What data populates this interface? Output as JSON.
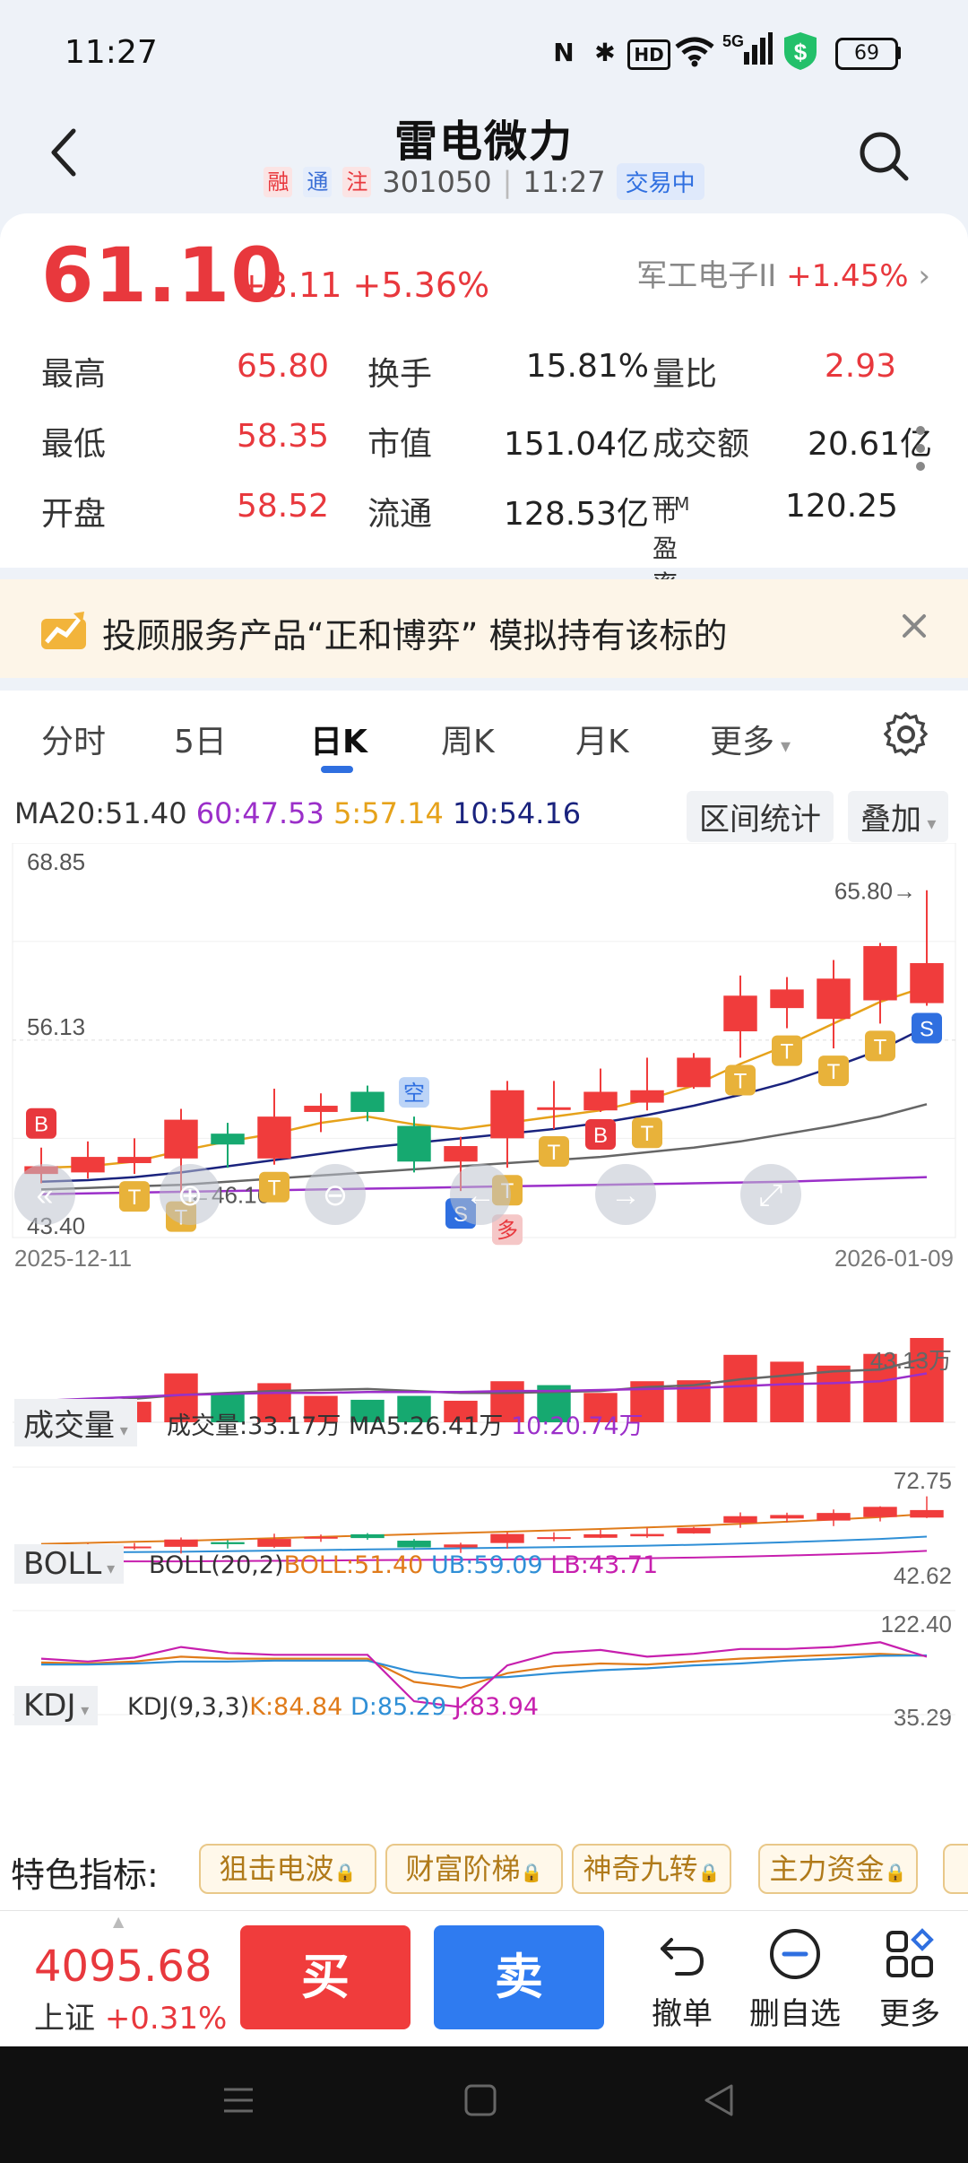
{
  "status_bar": {
    "time": "11:27",
    "nfc": "N",
    "hd": "HD",
    "net": "5G",
    "battery": "69"
  },
  "header": {
    "title": "雷电微力",
    "tags": [
      "融",
      "通",
      "注"
    ],
    "code": "301050",
    "time": "11:27",
    "trading_status": "交易中"
  },
  "quote": {
    "price": "61.10",
    "change": "+3.11",
    "change_pct": "+5.36%",
    "sector_name": "军工电子II",
    "sector_pct": "+1.45%",
    "rows": [
      {
        "l1": "最高",
        "v1": "65.80",
        "l2": "换手",
        "v2": "15.81%",
        "l3": "量比",
        "v3": "2.93"
      },
      {
        "l1": "最低",
        "v1": "58.35",
        "l2": "市值",
        "v2": "151.04亿",
        "l3": "成交额",
        "v3": "20.61亿"
      },
      {
        "l1": "开盘",
        "v1": "58.52",
        "l2": "流通",
        "v2": "128.53亿",
        "l3": "市盈率",
        "l3_sup": "TTM",
        "v3": "120.25"
      }
    ]
  },
  "banner": {
    "text": "投顾服务产品“正和博弈” 模拟持有该标的"
  },
  "tabs": [
    "分时",
    "5日",
    "日K",
    "周K",
    "月K",
    "更多"
  ],
  "active_tab": "日K",
  "ma_legend": {
    "ma20": "MA20:51.40",
    "ma60": "60:47.53",
    "ma5": "5:57.14",
    "ma10": "10:54.16"
  },
  "chart_buttons": {
    "range_stats": "区间统计",
    "overlay": "叠加"
  },
  "chart_data": [
    {
      "type": "candlestick",
      "y_labels": [
        "68.85",
        "56.13",
        "43.40"
      ],
      "high_label": "65.80",
      "low_label": "46.16",
      "x_start": "2025-12-11",
      "x_end": "2026-01-09",
      "candles": [
        {
          "o": 47.5,
          "c": 48.0,
          "h": 49.2,
          "l": 46.9
        },
        {
          "o": 47.6,
          "c": 48.6,
          "h": 49.6,
          "l": 47.2
        },
        {
          "o": 48.2,
          "c": 48.6,
          "h": 49.8,
          "l": 47.5
        },
        {
          "o": 48.5,
          "c": 51.0,
          "h": 51.7,
          "l": 46.2
        },
        {
          "o": 50.1,
          "c": 49.4,
          "h": 50.8,
          "l": 47.9
        },
        {
          "o": 48.5,
          "c": 51.2,
          "h": 53.0,
          "l": 48.1
        },
        {
          "o": 51.5,
          "c": 51.9,
          "h": 52.7,
          "l": 50.2
        },
        {
          "o": 52.8,
          "c": 51.5,
          "h": 53.2,
          "l": 50.9
        },
        {
          "o": 50.6,
          "c": 48.3,
          "h": 51.2,
          "l": 47.6
        },
        {
          "o": 48.3,
          "c": 49.3,
          "h": 49.9,
          "l": 46.4
        },
        {
          "o": 49.8,
          "c": 52.9,
          "h": 53.5,
          "l": 47.9
        },
        {
          "o": 51.8,
          "c": 51.8,
          "h": 53.5,
          "l": 50.4
        },
        {
          "o": 51.6,
          "c": 52.8,
          "h": 54.3,
          "l": 51.5
        },
        {
          "o": 52.1,
          "c": 52.9,
          "h": 55.0,
          "l": 51.6
        },
        {
          "o": 53.1,
          "c": 55.0,
          "h": 55.3,
          "l": 53.0
        },
        {
          "o": 56.7,
          "c": 59.0,
          "h": 60.3,
          "l": 55.0
        },
        {
          "o": 58.2,
          "c": 59.4,
          "h": 60.2,
          "l": 56.9
        },
        {
          "o": 57.5,
          "c": 60.1,
          "h": 61.3,
          "l": 55.6
        },
        {
          "o": 58.7,
          "c": 62.2,
          "h": 62.4,
          "l": 57.2
        },
        {
          "o": 58.52,
          "c": 61.1,
          "h": 65.8,
          "l": 58.35
        }
      ],
      "ma5": [
        47.9,
        48.0,
        48.3,
        49.0,
        49.6,
        50.1,
        50.8,
        51.2,
        50.7,
        50.4,
        50.8,
        51.2,
        51.6,
        52.3,
        53.2,
        54.6,
        55.8,
        57.2,
        58.6,
        59.6
      ],
      "ma10": [
        47.0,
        47.1,
        47.3,
        47.6,
        48.0,
        48.4,
        48.8,
        49.2,
        49.5,
        49.8,
        50.1,
        50.4,
        50.8,
        51.3,
        51.9,
        52.6,
        53.4,
        54.4,
        55.5,
        57.0
      ],
      "ma20": [
        46.5,
        46.6,
        46.7,
        46.8,
        47.0,
        47.2,
        47.4,
        47.6,
        47.8,
        48.0,
        48.2,
        48.4,
        48.6,
        48.9,
        49.2,
        49.6,
        50.1,
        50.6,
        51.2,
        52.0
      ],
      "ma60": [
        46.2,
        46.25,
        46.3,
        46.35,
        46.4,
        46.45,
        46.5,
        46.55,
        46.6,
        46.65,
        46.7,
        46.75,
        46.8,
        46.85,
        46.9,
        46.95,
        47.0,
        47.1,
        47.2,
        47.3
      ],
      "markers": [
        {
          "i": 0,
          "label": "B",
          "pos": "above",
          "color": "#e8383d"
        },
        {
          "i": 2,
          "label": "T",
          "pos": "below",
          "color": "#e8b23a"
        },
        {
          "i": 3,
          "label": "T",
          "pos": "below",
          "color": "#e8b23a"
        },
        {
          "i": 5,
          "label": "T",
          "pos": "below",
          "color": "#e8b23a"
        },
        {
          "i": 8,
          "label": "空",
          "pos": "above",
          "color": "#bcd4f7"
        },
        {
          "i": 9,
          "label": "S",
          "pos": "below",
          "color": "#2f6fe0"
        },
        {
          "i": 10,
          "label": "多",
          "pos": "below2",
          "color": "#f5c7c7"
        },
        {
          "i": 10,
          "label": "T",
          "pos": "below",
          "color": "#e8b23a"
        },
        {
          "i": 11,
          "label": "T",
          "pos": "below",
          "color": "#e8b23a"
        },
        {
          "i": 12,
          "label": "B",
          "pos": "below",
          "color": "#e8383d"
        },
        {
          "i": 13,
          "label": "T",
          "pos": "below",
          "color": "#e8b23a"
        },
        {
          "i": 15,
          "label": "T",
          "pos": "below",
          "color": "#e8b23a"
        },
        {
          "i": 16,
          "label": "T",
          "pos": "below",
          "color": "#e8b23a"
        },
        {
          "i": 17,
          "label": "T",
          "pos": "below",
          "color": "#e8b23a"
        },
        {
          "i": 18,
          "label": "T",
          "pos": "below",
          "color": "#e8b23a"
        },
        {
          "i": 19,
          "label": "S",
          "pos": "below",
          "color": "#2f6fe0"
        }
      ]
    },
    {
      "type": "bar",
      "title": "成交量",
      "legend": {
        "vol": "成交量:33.17万",
        "ma5": "MA5:26.41万",
        "ma10": "10:20.74万"
      },
      "max_label": "43.13万",
      "values": [
        8,
        9,
        10.5,
        25,
        15,
        20,
        13.5,
        11.5,
        13.5,
        11,
        21,
        19,
        15,
        21,
        21.5,
        34.5,
        31,
        29,
        35,
        43.13
      ],
      "up": [
        true,
        true,
        true,
        true,
        false,
        true,
        true,
        false,
        false,
        true,
        true,
        false,
        true,
        true,
        true,
        true,
        true,
        true,
        true,
        true
      ],
      "ma5": [
        9,
        10,
        12,
        14,
        15,
        16,
        16.5,
        17,
        16,
        15,
        15,
        15.5,
        16,
        18,
        19,
        22,
        24,
        26,
        27,
        33
      ],
      "ma10": [
        11,
        12,
        13,
        14,
        14.5,
        15,
        15,
        15.5,
        15.5,
        15.5,
        16,
        16,
        16.5,
        17,
        17.5,
        18.5,
        19.5,
        20,
        21,
        25
      ]
    },
    {
      "type": "line",
      "title": "BOLL",
      "legend": {
        "param": "BOLL(20,2)",
        "boll": "BOLL:51.40",
        "ub": "UB:59.09",
        "lb": "LB:43.71"
      },
      "max_label": "72.75",
      "min_label": "42.62"
    },
    {
      "type": "line",
      "title": "KDJ",
      "legend": {
        "param": "KDJ(9,3,3)",
        "k": "K:84.84",
        "d": "D:85.29",
        "j": "J:83.94"
      },
      "max_label": "122.40",
      "min_label": "35.29",
      "K": [
        78,
        77,
        79,
        84,
        82,
        82,
        82,
        82,
        58,
        52,
        67,
        74,
        77,
        76,
        79,
        82,
        84,
        86,
        87,
        84.84
      ],
      "D": [
        76,
        76,
        77,
        79,
        79,
        80,
        80,
        80,
        68,
        62,
        63,
        67,
        70,
        72,
        75,
        77,
        80,
        82,
        85,
        85.29
      ],
      "J": [
        82,
        79,
        83,
        94,
        88,
        86,
        86,
        86,
        38,
        32,
        75,
        88,
        91,
        84,
        87,
        92,
        92,
        94,
        99,
        83.94
      ]
    }
  ],
  "features": {
    "label": "特色指标:",
    "items": [
      "狙击电波",
      "财富阶梯",
      "神奇九转",
      "主力资金"
    ]
  },
  "bottom": {
    "index_value": "4095.68",
    "index_name": "上证",
    "index_change": "+0.31%",
    "buy": "买",
    "sell": "卖",
    "actions": [
      "撤单",
      "删自选",
      "更多"
    ]
  }
}
